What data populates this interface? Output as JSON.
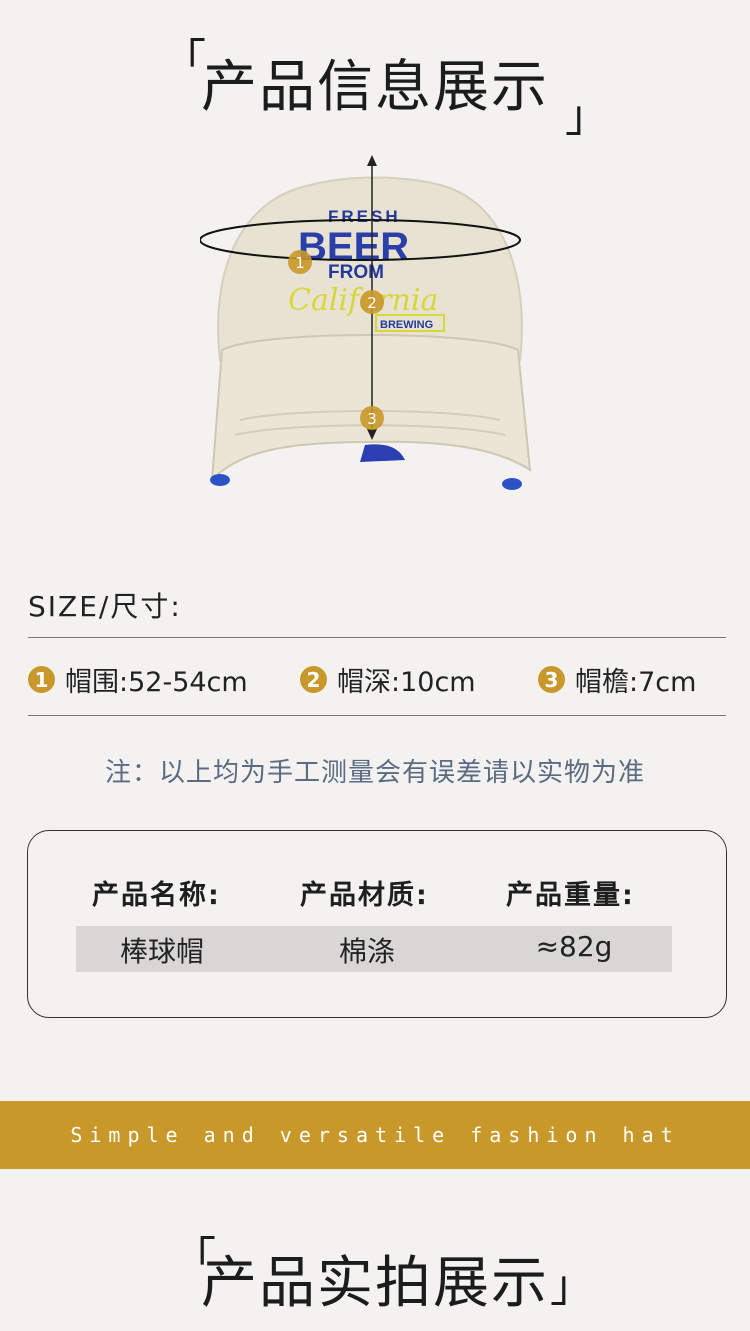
{
  "top_title": {
    "open_bracket": "「",
    "text": "产品信息展示",
    "close_bracket": "」"
  },
  "hat_image": {
    "markers": [
      "1",
      "2",
      "3"
    ],
    "embroidery": [
      "FRESH",
      "BEER",
      "FROM",
      "California",
      "BREWING"
    ]
  },
  "size_section": {
    "label": "SIZE/尺寸:",
    "items": [
      {
        "num": "1",
        "text": "帽围:52-54cm"
      },
      {
        "num": "2",
        "text": "帽深:10cm"
      },
      {
        "num": "3",
        "text": "帽檐:7cm"
      }
    ],
    "note": "注：以上均为手工测量会有误差请以实物为准"
  },
  "info_table": {
    "headers": [
      "产品名称:",
      "产品材质:",
      "产品重量:"
    ],
    "values": [
      "棒球帽",
      "棉涤",
      "≈82g"
    ]
  },
  "banner": {
    "text": "Simple and versatile fashion hat"
  },
  "bottom_title": {
    "open_bracket": "「",
    "text": "产品实拍展示",
    "close_bracket": "」"
  },
  "colors": {
    "accent": "#c9982a",
    "background": "#f3f2f0",
    "note_text": "#5a6b82"
  }
}
